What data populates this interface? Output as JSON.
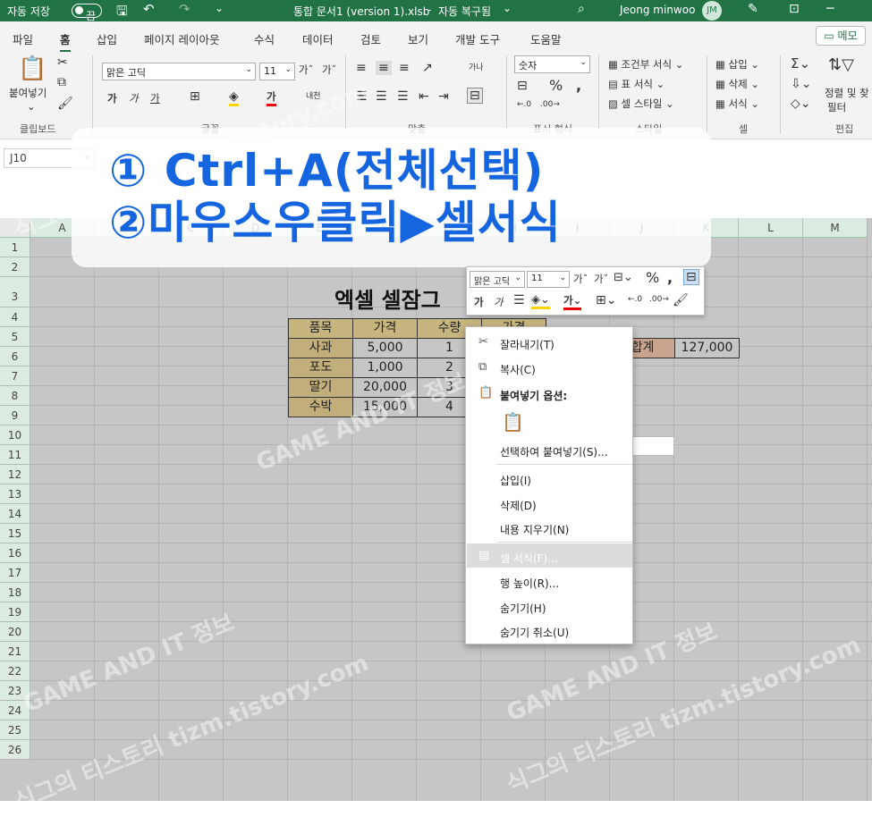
{
  "titlebar": {
    "autosave_label": "자동 저장",
    "autosave_state": "끔",
    "file_title": "통합 문서1 (version 1).xlsb",
    "recovery_label": "자동 복구됨",
    "user_name": "Jeong minwoo",
    "user_initials": "JM"
  },
  "menu": {
    "tabs": [
      "파일",
      "홈",
      "삽입",
      "페이지 레이아웃",
      "수식",
      "데이터",
      "검토",
      "보기",
      "개발 도구",
      "도움말"
    ],
    "active_tab": "홈",
    "memo_label": "메모"
  },
  "ribbon": {
    "paste_label": "붙여넣기",
    "font_name": "맑은 고딕",
    "font_size": "11",
    "number_format": "숫자",
    "conditional_format": "조건부 서식",
    "table_format": "표 서식",
    "cell_style": "셀 스타일",
    "insert": "삽입",
    "delete": "삭제",
    "format": "서식",
    "sort_filter": "정렬 및 찾",
    "filter": "필터",
    "groups": {
      "clipboard": "클립보드",
      "font": "글꼴",
      "alignment": "맞춤",
      "number": "표시 형식",
      "style": "스타일",
      "cells": "셀",
      "editing": "편집"
    }
  },
  "formula_bar": {
    "name_box": "J10"
  },
  "overlay": {
    "line1": "① Ctrl+A(전체선택)",
    "line2": "②마우스우클릭▶셀서식"
  },
  "sheet": {
    "columns": [
      "A",
      "B",
      "C",
      "D",
      "E",
      "F",
      "G",
      "H",
      "I",
      "J",
      "K",
      "L",
      "M"
    ],
    "rows": [
      "1",
      "2",
      "3",
      "4",
      "5",
      "6",
      "7",
      "8",
      "9",
      "10",
      "11",
      "12",
      "13",
      "14",
      "15",
      "16",
      "17",
      "18",
      "19",
      "20",
      "21",
      "22",
      "23",
      "24",
      "25",
      "26"
    ],
    "title": "엑셀 셀잠그",
    "table_headers": [
      "품목",
      "가격",
      "수량",
      "가격"
    ],
    "table_rows": [
      [
        "사과",
        "5,000",
        "1"
      ],
      [
        "포도",
        "1,000",
        "2"
      ],
      [
        "딸기",
        "20,000",
        "3"
      ],
      [
        "수박",
        "15,000",
        "4"
      ]
    ],
    "total_label": "합계",
    "total_value": "127,000"
  },
  "mini_toolbar": {
    "font_name": "맑은 고딕",
    "font_size": "11"
  },
  "context_menu": {
    "cut": "잘라내기(T)",
    "copy": "복사(C)",
    "paste_options": "붙여넣기 옵션:",
    "paste_special": "선택하여 붙여넣기(S)...",
    "insert": "삽입(I)",
    "delete": "삭제(D)",
    "clear": "내용 지우기(N)",
    "format_cells": "셀 서식(F)...",
    "row_height": "행 높이(R)...",
    "hide": "숨기기(H)",
    "unhide": "숨기기 취소(U)"
  },
  "watermark": {
    "text1": "GAME AND IT 정보",
    "text2": "식그의 티스토리 tizm.tistory.com"
  }
}
